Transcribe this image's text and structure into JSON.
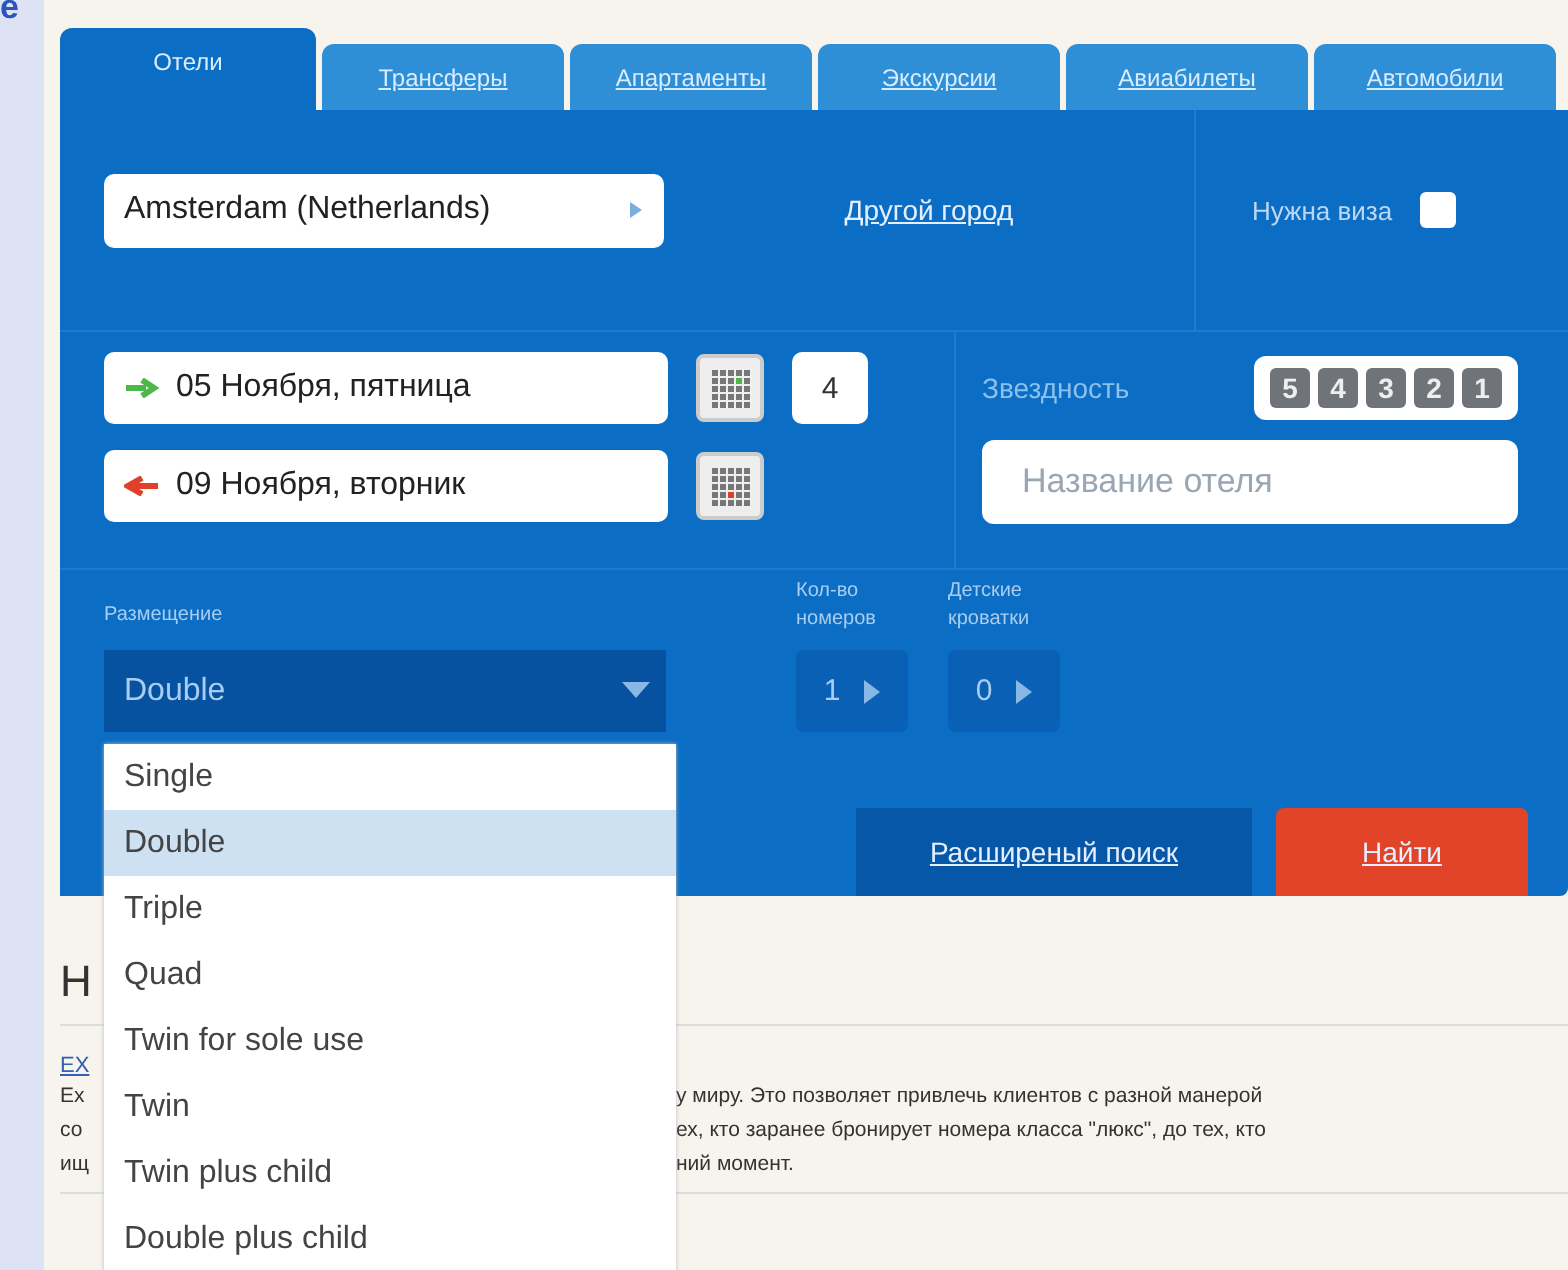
{
  "corner_text": "e",
  "tabs": [
    {
      "label": "Отели",
      "selected": true
    },
    {
      "label": "Трансферы",
      "selected": false
    },
    {
      "label": "Апартаменты",
      "selected": false
    },
    {
      "label": "Экскурсии",
      "selected": false
    },
    {
      "label": "Авиабилеты",
      "selected": false
    },
    {
      "label": "Автомобили",
      "selected": false
    }
  ],
  "city": {
    "value": "Amsterdam (Netherlands)",
    "other_city_link": "Другой город"
  },
  "visa": {
    "label": "Нужна виза",
    "checked": false
  },
  "dates": [
    {
      "kind": "arrival",
      "value": "05 Ноября, пятница"
    },
    {
      "kind": "departure",
      "value": "09 Ноября, вторник"
    }
  ],
  "nights": "4",
  "stars": {
    "label": "Звездность",
    "options": [
      "5",
      "4",
      "3",
      "2",
      "1"
    ]
  },
  "hotel_name": {
    "placeholder": "Название отеля"
  },
  "accommodation": {
    "label": "Размещение",
    "value": "Double",
    "expanded": true,
    "options": [
      {
        "label": "Single",
        "selected": false
      },
      {
        "label": "Double",
        "selected": true
      },
      {
        "label": "Triple",
        "selected": false
      },
      {
        "label": "Quad",
        "selected": false
      },
      {
        "label": "Twin for sole use",
        "selected": false
      },
      {
        "label": "Twin",
        "selected": false
      },
      {
        "label": "Twin plus child",
        "selected": false
      },
      {
        "label": "Double plus child",
        "selected": false
      }
    ]
  },
  "rooms": {
    "label": "Кол-во номеров",
    "value": "1"
  },
  "cots": {
    "label": "Детские кроватки",
    "value": "0"
  },
  "advanced_search": "Расширеный поиск",
  "search_button": "Найти",
  "below": {
    "heading": "Н",
    "link": "EX",
    "left_lines": [
      "Ex",
      "со",
      "ищ"
    ],
    "right_lines": [
      "у миру. Это позволяет привлечь клиентов с разной манерой",
      "ех, кто заранее бронирует номера класса \"люкс\", до тех, кто",
      "ний момент."
    ]
  }
}
